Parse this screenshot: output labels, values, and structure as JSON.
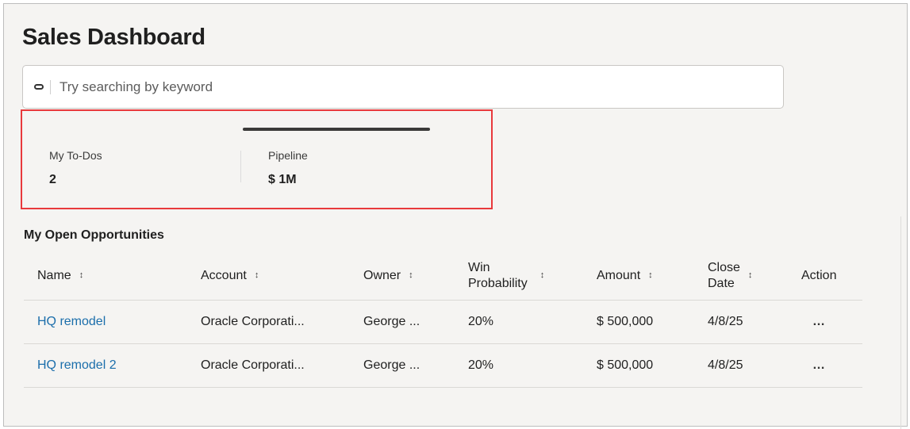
{
  "page": {
    "title": "Sales Dashboard"
  },
  "search": {
    "placeholder": "Try searching by keyword"
  },
  "metrics": [
    {
      "label": "My To-Dos",
      "value": "2"
    },
    {
      "label": "Pipeline",
      "value": "$ 1M"
    }
  ],
  "opportunities": {
    "title": "My Open Opportunities",
    "columns": {
      "name": "Name",
      "account": "Account",
      "owner": "Owner",
      "win_line1": "Win",
      "win_line2": "Probability",
      "amount": "Amount",
      "close_line1": "Close",
      "close_line2": "Date",
      "action": "Action"
    },
    "rows": [
      {
        "name": "HQ remodel",
        "account": "Oracle Corporati...",
        "owner": "George ...",
        "win": "20%",
        "amount": "$ 500,000",
        "close": "4/8/25",
        "action": "…"
      },
      {
        "name": "HQ remodel 2",
        "account": "Oracle Corporati...",
        "owner": "George ...",
        "win": "20%",
        "amount": "$ 500,000",
        "close": "4/8/25",
        "action": "…"
      }
    ]
  },
  "icons": {
    "sort": "↕",
    "search": "search-icon"
  },
  "colors": {
    "highlight_border": "#e8393c",
    "link": "#1b6eab"
  }
}
